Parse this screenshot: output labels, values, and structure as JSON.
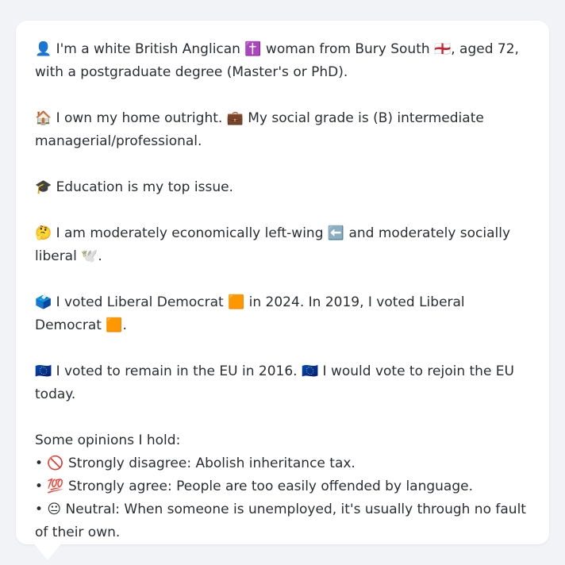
{
  "profile": {
    "p1": "👤 I'm a white British Anglican ✝️ woman from Bury South 🏴󠁧󠁢󠁥󠁮󠁧󠁿, aged 72, with a postgraduate degree (Master's or PhD).",
    "p2": "🏠 I own my home outright. 💼 My social grade is (B) intermediate managerial/professional.",
    "p3": "🎓 Education is my top issue.",
    "p4": "🤔 I am moderately economically left-wing ⬅️ and moderately socially liberal 🕊️.",
    "p5": "🗳️ I voted Liberal Democrat 🟧 in 2024. In 2019, I voted Liberal Democrat 🟧.",
    "p6": "🇪🇺 I voted to remain in the EU in 2016. 🇪🇺 I would vote to rejoin the EU today.",
    "opinions_title": "Some opinions I hold:",
    "opinions": [
      "• 🚫 Strongly disagree: Abolish inheritance tax.",
      "• 💯 Strongly agree: People are too easily offended by language.",
      "• 😐 Neutral: When someone is unemployed, it's usually through no fault of their own."
    ]
  }
}
